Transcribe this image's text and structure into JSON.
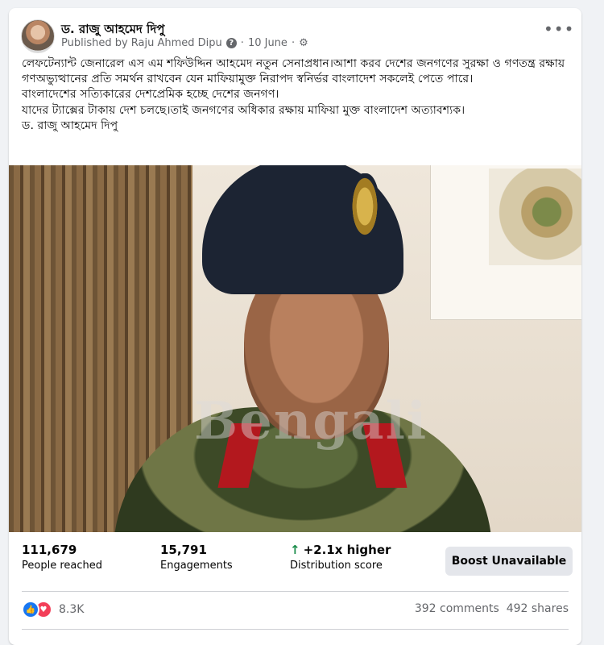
{
  "post": {
    "author": "ড. রাজু আহমেদ দিপু",
    "published_by": "Published by Raju Ahmed Dipu",
    "date": "10 June",
    "more_label": "•••",
    "paragraphs": [
      "লেফটেন্যান্ট জেনারেল এস এম শফিউদ্দিন আহমেদ নতুন সেনাপ্রধান।আশা করব দেশের জনগণের সুরক্ষা ও গণতন্ত্র রক্ষায় গণঅভ্যুত্থানের প্রতি সমর্থন রাখবেন যেন মাফিয়ামুক্ত নিরাপদ স্বনির্ভর বাংলাদেশ সকলেই পেতে পারে।",
      "বাংলাদেশের সত্যিকারের দেশপ্রেমিক হচ্ছে দেশের জনগণ।",
      "যাদের ট্যাক্সের টাকায় দেশ চলছে।তাই জনগণের অধিকার রক্ষায় মাফিয়া মুক্ত বাংলাদেশ অত্যাবশ্যক।",
      "ড. রাজু আহমেদ দিপু"
    ],
    "watermark": "Bengali"
  },
  "stats": {
    "reached_value": "111,679",
    "reached_label": "People reached",
    "engagements_value": "15,791",
    "engagements_label": "Engagements",
    "distribution_value": "+2.1x higher",
    "distribution_label": "Distribution score",
    "boost_label": "Boost Unavailable"
  },
  "reactions": {
    "count": "8.3K",
    "comments": "392 comments",
    "shares": "492 shares"
  },
  "colors": {
    "background": "#f0f2f5",
    "like": "#1877f2",
    "love": "#f33e58",
    "positive": "#1a8c4a"
  },
  "icons": [
    "gear-icon",
    "info-icon",
    "arrow-up-icon",
    "like-icon",
    "love-icon",
    "more-icon"
  ]
}
